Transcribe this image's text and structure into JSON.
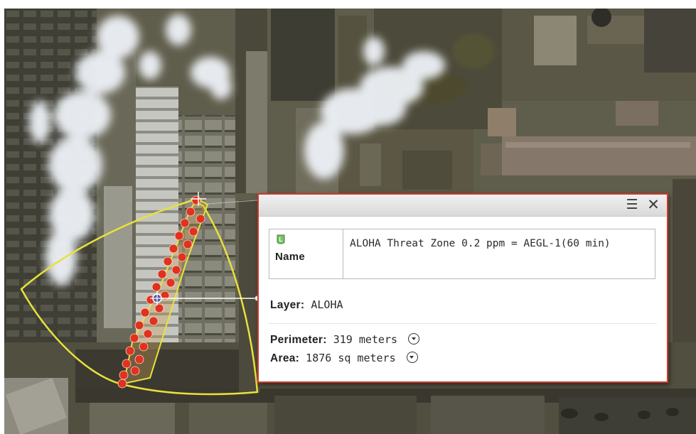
{
  "map": {
    "basemap": "satellite-imagery",
    "threat_zone_color": "#e8e23a",
    "plume_marker_color": "#e0321e",
    "leader_line_color": "#ffffff"
  },
  "popup": {
    "border_color": "#d2382a",
    "menu_icon": "menu-icon",
    "close_icon": "close-icon",
    "name_icon": "layer-feature-icon",
    "name_label": "Name",
    "name_value": "ALOHA Threat Zone 0.2 ppm = AEGL-1(60 min)",
    "layer_label": "Layer:",
    "layer_value": "ALOHA",
    "perimeter_label": "Perimeter:",
    "perimeter_value": "319 meters",
    "area_label": "Area:",
    "area_value": "1876 sq meters",
    "dropdown_icon": "chevron-down-circle-icon"
  }
}
